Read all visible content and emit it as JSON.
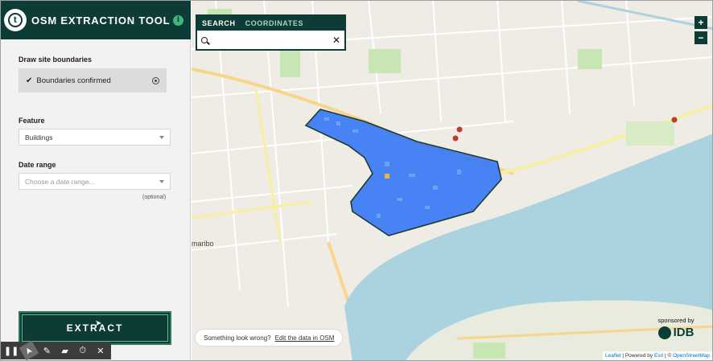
{
  "header": {
    "title": "OSM EXTRACTION TOOL",
    "logo_letter": "t",
    "info_glyph": "i"
  },
  "sidebar": {
    "boundaries": {
      "label": "Draw site boundaries",
      "status": "Boundaries confirmed"
    },
    "feature": {
      "label": "Feature",
      "value": "Buildings"
    },
    "date_range": {
      "label": "Date range",
      "placeholder": "Choose a date range...",
      "note": "(optional)"
    },
    "extract_label": "EXTRACT"
  },
  "recorder": {
    "icons": [
      "pause-icon",
      "pointer-icon",
      "pen-icon",
      "highlighter-icon",
      "timer-icon",
      "close-icon"
    ],
    "glyphs": [
      "❚❚",
      "➤",
      "✎",
      "▰",
      "⏱",
      "✕"
    ]
  },
  "search": {
    "tabs": [
      "SEARCH",
      "COORDINATES"
    ],
    "value": "",
    "clear_glyph": "✕"
  },
  "zoom": {
    "in": "+",
    "out": "−"
  },
  "map": {
    "place_labels": [
      "maribo"
    ],
    "colors": {
      "water": "#aad3df",
      "land": "#f2efe9",
      "park": "#c8e6b4",
      "selection": "#3478f6",
      "boundary": "#1f3a2e"
    }
  },
  "feedback": {
    "text": "Something look wrong?",
    "link": "Edit the data in OSM"
  },
  "sponsor": {
    "text": "sponsored by",
    "logo": "IDB"
  },
  "attribution": {
    "leaflet": "Leaflet",
    "powered": "| Powered by",
    "esri": "Esri",
    "sep": "| ©",
    "osm": "OpenStreetMap"
  },
  "colors": {
    "brand": "#0d3b35",
    "accent": "#3fb57a"
  }
}
